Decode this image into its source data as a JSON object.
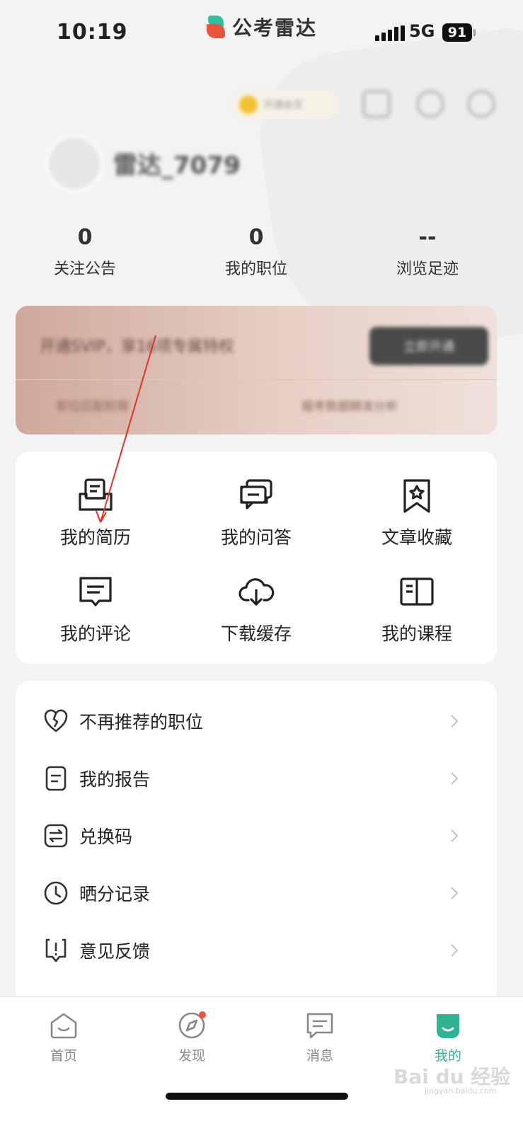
{
  "status_bar": {
    "time": "10:19",
    "network": "5G",
    "battery": "91"
  },
  "brand": {
    "name": "公考雷达"
  },
  "header": {
    "vip_text": "开通会员",
    "username": "雷达_7079"
  },
  "stats": [
    {
      "value": "0",
      "label": "关注公告"
    },
    {
      "value": "0",
      "label": "我的职位"
    },
    {
      "value": "--",
      "label": "浏览足迹"
    }
  ],
  "promo": {
    "headline": "开通SVIP，享16项专属特权",
    "button": "立即开通",
    "feature_1": "职位匹配权限",
    "feature_2": "报考数据精准分析"
  },
  "shortcuts": [
    {
      "label": "我的简历",
      "icon": "resume-icon"
    },
    {
      "label": "我的问答",
      "icon": "qa-icon"
    },
    {
      "label": "文章收藏",
      "icon": "bookmark-star-icon"
    },
    {
      "label": "我的评论",
      "icon": "comment-icon"
    },
    {
      "label": "下载缓存",
      "icon": "cloud-download-icon"
    },
    {
      "label": "我的课程",
      "icon": "book-icon"
    }
  ],
  "menu": [
    {
      "label": "不再推荐的职位",
      "icon": "broken-heart-icon"
    },
    {
      "label": "我的报告",
      "icon": "report-icon"
    },
    {
      "label": "兑换码",
      "icon": "exchange-icon"
    },
    {
      "label": "晒分记录",
      "icon": "clock-icon"
    },
    {
      "label": "意见反馈",
      "icon": "feedback-icon"
    }
  ],
  "tabs": [
    {
      "label": "首页",
      "icon": "home-icon"
    },
    {
      "label": "发现",
      "icon": "compass-icon"
    },
    {
      "label": "消息",
      "icon": "message-icon"
    },
    {
      "label": "我的",
      "icon": "profile-icon"
    }
  ],
  "watermark": {
    "text": "Bai du 经验",
    "sub": "jingyan.baidu.com"
  },
  "colors": {
    "accent": "#2fb392",
    "badge": "#e9533f",
    "annotation_arrow": "#e0312a"
  }
}
